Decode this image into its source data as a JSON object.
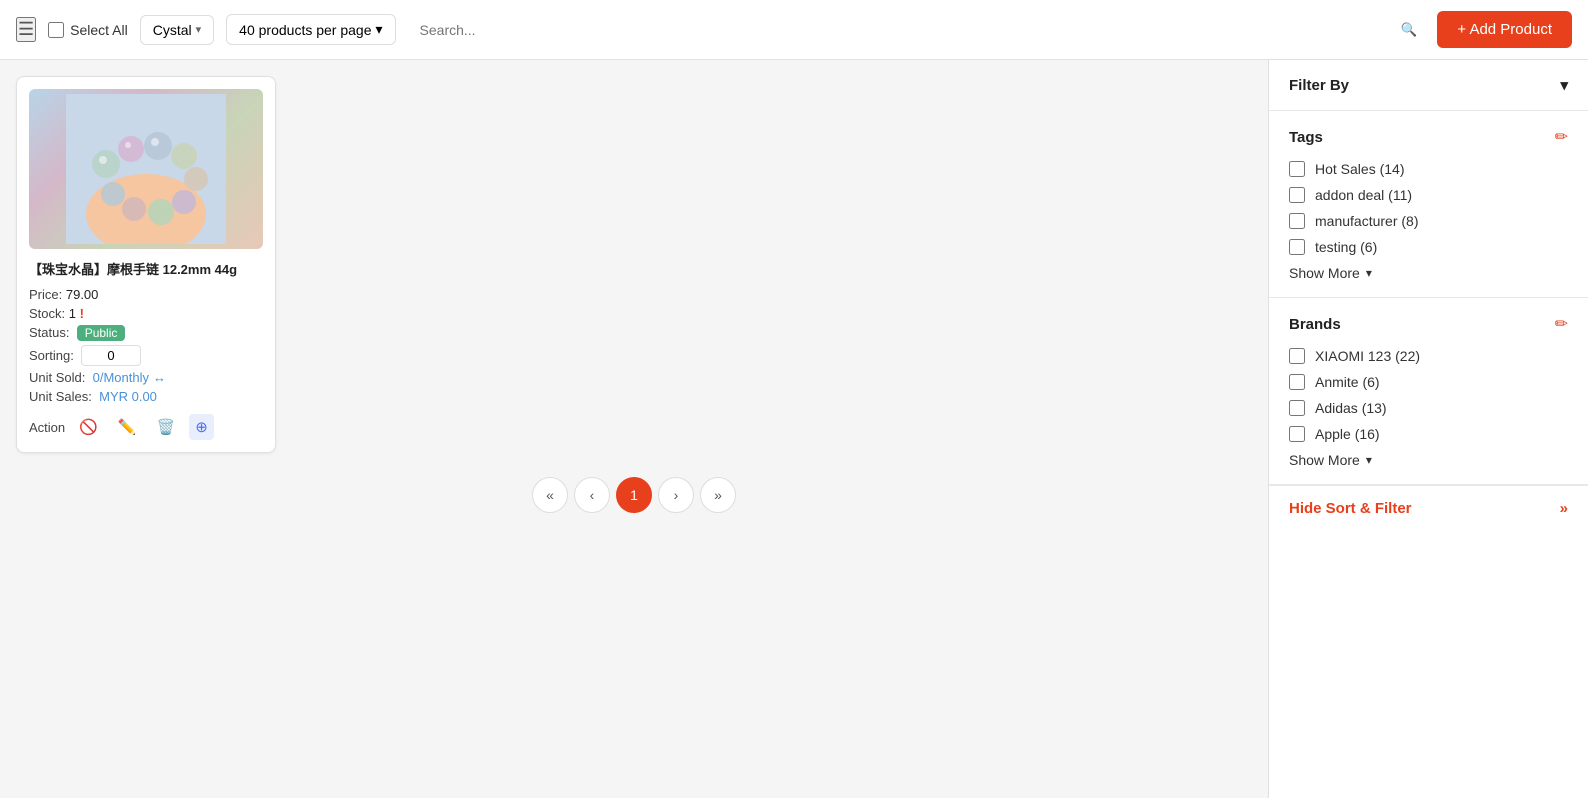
{
  "topbar": {
    "select_all_label": "Select All",
    "store_name": "Cystal",
    "per_page": "40 products per page",
    "search_placeholder": "Search...",
    "add_product_label": "+ Add Product"
  },
  "product": {
    "title": "【珠宝水晶】摩根手链 12.2mm 44g",
    "price_label": "Price:",
    "price_value": "79.00",
    "stock_label": "Stock:",
    "stock_value": "1",
    "stock_warning": "!",
    "status_label": "Status:",
    "status_value": "Public",
    "sorting_label": "Sorting:",
    "sorting_value": "0",
    "unit_sold_label": "Unit Sold:",
    "unit_sold_value": "0/Monthly",
    "unit_sales_label": "Unit Sales:",
    "unit_sales_value": "MYR 0.00",
    "action_label": "Action"
  },
  "pagination": {
    "first": "«",
    "prev": "‹",
    "current": "1",
    "next": "›",
    "last": "»"
  },
  "filter": {
    "title": "Filter By",
    "tags_section": {
      "title": "Tags",
      "items": [
        {
          "label": "Hot Sales (14)"
        },
        {
          "label": "addon deal (11)"
        },
        {
          "label": "manufacturer (8)"
        },
        {
          "label": "testing (6)"
        }
      ],
      "show_more": "Show More"
    },
    "brands_section": {
      "title": "Brands",
      "items": [
        {
          "label": "XIAOMI 123 (22)"
        },
        {
          "label": "Anmite (6)"
        },
        {
          "label": "Adidas (13)"
        },
        {
          "label": "Apple (16)"
        }
      ],
      "show_more": "Show More"
    },
    "hide_label": "Hide Sort & Filter"
  }
}
